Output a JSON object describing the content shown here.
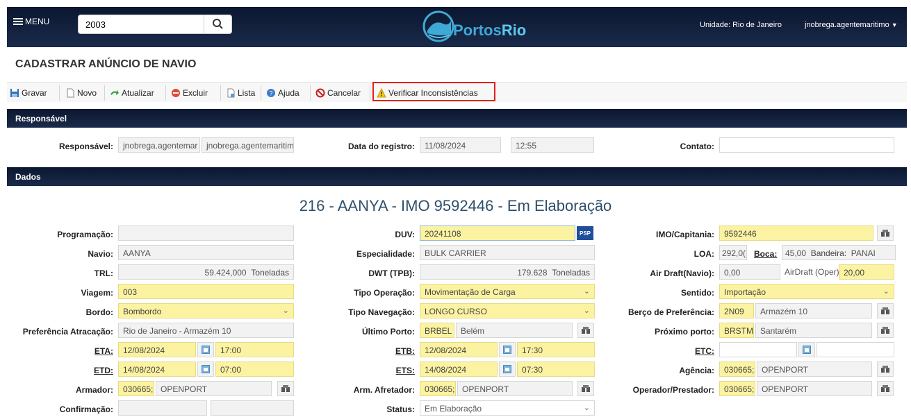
{
  "header": {
    "menu_label": "MENU",
    "search_value": "2003",
    "logo_text_a": "Portos",
    "logo_text_b": "Rio",
    "unit": "Unidade: Rio de Janeiro",
    "user": "jnobrega.agentemaritimo"
  },
  "page": {
    "title": "CADASTRAR ANÚNCIO DE NAVIO"
  },
  "toolbar": {
    "gravar": "Gravar",
    "novo": "Novo",
    "atualizar": "Atualizar",
    "excluir": "Excluir",
    "lista": "Lista",
    "ajuda": "Ajuda",
    "cancelar": "Cancelar",
    "verificar": "Verificar Inconsistências"
  },
  "responsavel": {
    "section": "Responsável",
    "label": "Responsável:",
    "v1": "jnobrega.agentemar",
    "v2": "jnobrega.agentemaritimo",
    "data_label": "Data do registro:",
    "data": "11/08/2024",
    "hora": "12:55",
    "contato_label": "Contato:",
    "contato": ""
  },
  "dados": {
    "section": "Dados",
    "headline": "216 - AANYA - IMO 9592446 - Em Elaboração",
    "programacao_label": "Programação:",
    "programacao": "",
    "navio_label": "Navio:",
    "navio": "AANYA",
    "trl_label": "TRL:",
    "trl": "59.424,000",
    "trl_unit": "Toneladas",
    "viagem_label": "Viagem:",
    "viagem": "003",
    "bordo_label": "Bordo:",
    "bordo": "Bombordo",
    "pref_label": "Preferência Atracação:",
    "pref": "Rio de Janeiro - Armazém 10",
    "eta_label": "ETA:",
    "eta_date": "12/08/2024",
    "eta_time": "17:00",
    "etd_label": "ETD:",
    "etd_date": "14/08/2024",
    "etd_time": "07:00",
    "armador_label": "Armador:",
    "armador_code": "030665;",
    "armador_name": "OPENPORT",
    "confirmacao_label": "Confirmação:",
    "duv_label": "DUV:",
    "duv": "20241108",
    "esp_label": "Especialidade:",
    "esp": "BULK CARRIER",
    "dwt_label": "DWT (TPB):",
    "dwt": "179.628",
    "dwt_unit": "Toneladas",
    "tipo_op_label": "Tipo Operação:",
    "tipo_op": "Movimentação de Carga",
    "tipo_nav_label": "Tipo Navegação:",
    "tipo_nav": "LONGO CURSO",
    "ult_porto_label": "Último Porto:",
    "ult_porto_code": "BRBEL",
    "ult_porto_name": "Belém",
    "etb_label": "ETB:",
    "etb_date": "12/08/2024",
    "etb_time": "17:30",
    "ets_label": "ETS:",
    "ets_date": "14/08/2024",
    "ets_time": "07:30",
    "arm_afr_label": "Arm. Afretador:",
    "arm_afr_code": "030665;",
    "arm_afr_name": "OPENPORT",
    "status_label": "Status:",
    "status": "Em Elaboração",
    "imo_label": "IMO/Capitania:",
    "imo": "9592446",
    "loa_label": "LOA:",
    "loa": "292,0(",
    "boca_label": "Boca:",
    "boca": "45,00",
    "bandeira_label": "Bandeira:",
    "bandeira": "PANAI",
    "airdraft_label": "Air Draft(Navio):",
    "airdraft": "0,00",
    "airdraft_oper_label": "AirDraft (Oper):",
    "airdraft_oper": "20,00",
    "sentido_label": "Sentido:",
    "sentido": "Importação",
    "berco_label": "Berço de Preferência:",
    "berco_code": "2N09",
    "berco_name": "Armazém 10",
    "prox_label": "Próximo porto:",
    "prox_code": "BRSTM",
    "prox_name": "Santarém",
    "etc_label": "ETC:",
    "agencia_label": "Agência:",
    "agencia_code": "030665;",
    "agencia_name": "OPENPORT",
    "operador_label": "Operador/Prestador:",
    "operador_code": "030665;",
    "operador_name": "OPENPORT"
  }
}
